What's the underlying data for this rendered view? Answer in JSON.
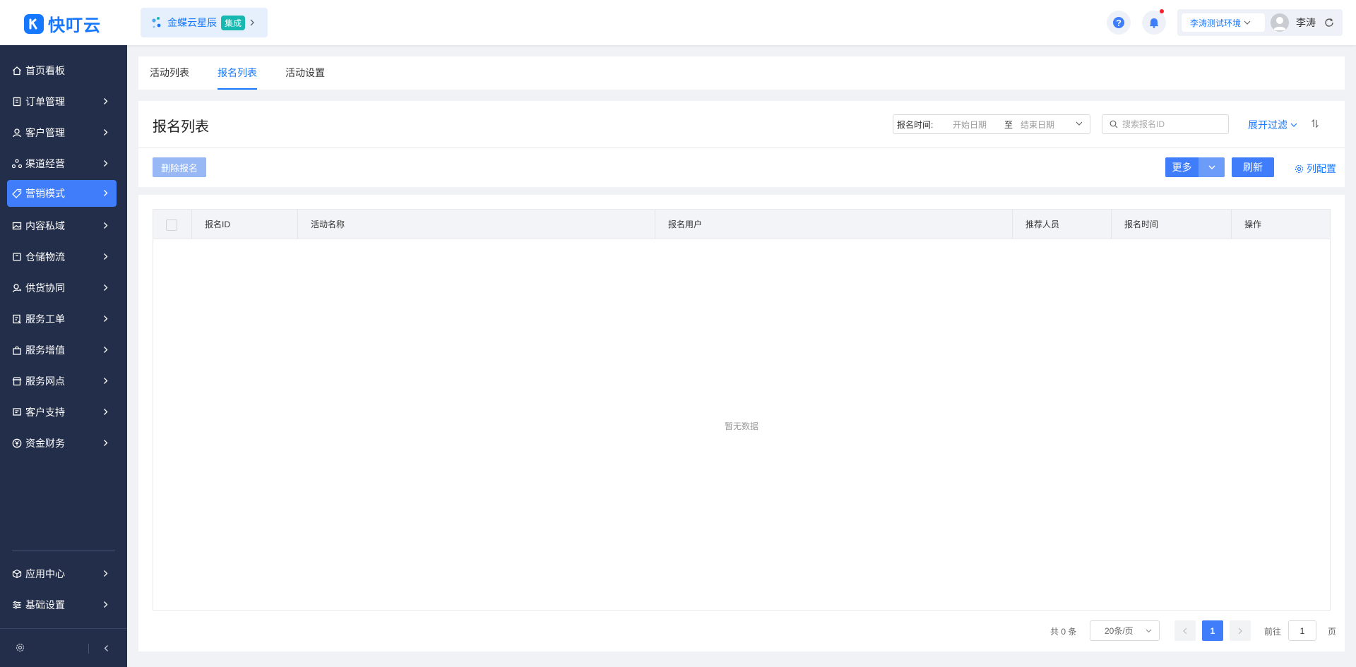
{
  "header": {
    "logo_text": "快叮云",
    "brand": {
      "name": "金蝶云星辰",
      "tag": "集成"
    },
    "environment": "李涛测试环境",
    "user_name": "李涛"
  },
  "sidebar": {
    "items": [
      {
        "label": "首页看板",
        "icon": "home-icon"
      },
      {
        "label": "订单管理",
        "icon": "order-icon"
      },
      {
        "label": "客户管理",
        "icon": "user-icon"
      },
      {
        "label": "渠道经营",
        "icon": "channel-icon"
      },
      {
        "label": "营销模式",
        "icon": "tag-icon",
        "active": true
      },
      {
        "label": "内容私域",
        "icon": "image-icon"
      },
      {
        "label": "仓储物流",
        "icon": "box-icon"
      },
      {
        "label": "供货协同",
        "icon": "supplier-icon"
      },
      {
        "label": "服务工单",
        "icon": "ticket-icon"
      },
      {
        "label": "服务增值",
        "icon": "bag-icon"
      },
      {
        "label": "服务网点",
        "icon": "store-icon"
      },
      {
        "label": "客户支持",
        "icon": "support-icon"
      },
      {
        "label": "资金财务",
        "icon": "yen-icon"
      }
    ],
    "bottom_items": [
      {
        "label": "应用中心",
        "icon": "cube-icon"
      },
      {
        "label": "基础设置",
        "icon": "settings-icon"
      }
    ]
  },
  "tabs": [
    {
      "label": "活动列表"
    },
    {
      "label": "报名列表",
      "active": true
    },
    {
      "label": "活动设置"
    }
  ],
  "main": {
    "title": "报名列表",
    "date_filter": {
      "label": "报名时间:",
      "start_placeholder": "开始日期",
      "separator": "至",
      "end_placeholder": "结束日期"
    },
    "search_placeholder": "搜索报名ID",
    "expand_filter": "展开过滤",
    "delete_button": "删除报名",
    "more_button": "更多",
    "refresh_button": "刷新",
    "column_config": "列配置"
  },
  "table": {
    "columns": [
      "报名ID",
      "活动名称",
      "报名用户",
      "推荐人员",
      "报名时间",
      "操作"
    ],
    "rows": [],
    "empty_text": "暂无数据"
  },
  "pagination": {
    "total_text": "共 0 条",
    "page_size": "20条/页",
    "current_page": "1",
    "goto_label": "前往",
    "goto_value": "1",
    "page_suffix": "页"
  },
  "colors": {
    "primary": "#1677ff",
    "button": "#3f7dfa",
    "sidebar_bg": "#232e4a",
    "brand_tag": "#16b8b0"
  }
}
